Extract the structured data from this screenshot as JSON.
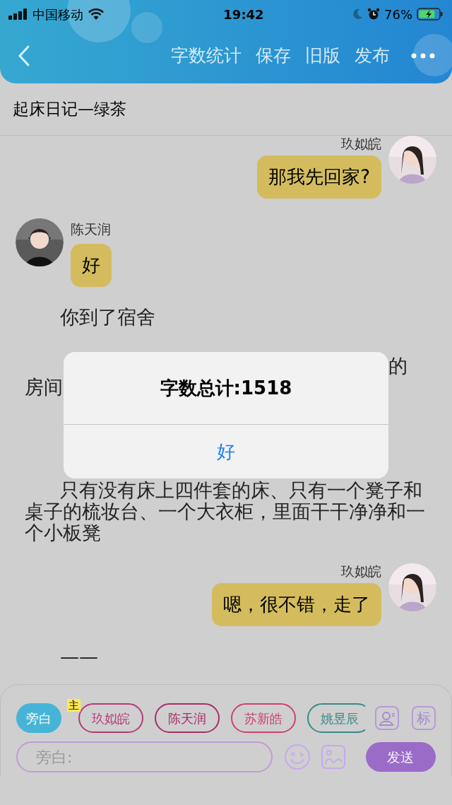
{
  "status_bar": {
    "carrier": "中国移动",
    "time": "19:42",
    "battery": "76%"
  },
  "nav": {
    "actions": [
      "字数统计",
      "保存",
      "旧版",
      "发布"
    ]
  },
  "title": "起床日记—绿茶",
  "messages": [
    {
      "kind": "outgoing",
      "name": "玖姒皖",
      "text": "那我先回家?"
    },
    {
      "kind": "incoming",
      "name": "陈天润",
      "text": "好"
    },
    {
      "kind": "narration",
      "text": "你到了宿舍"
    },
    {
      "kind": "covered",
      "right": "的",
      "left": "房间"
    },
    {
      "kind": "narration",
      "text": "只有没有床上四件套的床、只有一个凳子和桌子的梳妆台、一个大衣柜，里面干干净净和一个小板凳"
    },
    {
      "kind": "outgoing",
      "name": "玖姒皖",
      "text": "嗯，很不错，走了"
    },
    {
      "kind": "narration",
      "text": "——"
    }
  ],
  "dialog": {
    "message": "字数总计:1518",
    "button": "好"
  },
  "roles": [
    {
      "label": "旁白",
      "selected": true,
      "color": "#46b4d6"
    },
    {
      "label": "玖姒皖",
      "selected": false,
      "color": "#b43a78",
      "badge": "主"
    },
    {
      "label": "陈天润",
      "selected": false,
      "color": "#a52d6a"
    },
    {
      "label": "苏新皓",
      "selected": false,
      "color": "#d0406e"
    },
    {
      "label": "姚昱辰",
      "selected": false,
      "color": "#3a8a8a"
    }
  ],
  "tag_button": "标",
  "input": {
    "placeholder": "旁白:"
  },
  "send": "发送"
}
